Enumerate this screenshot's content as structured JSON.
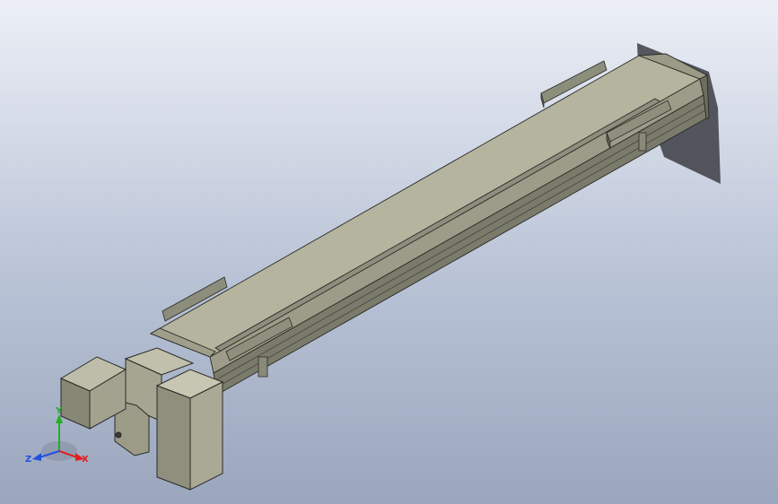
{
  "viewport": {
    "background_top": "#eceff6",
    "background_bottom": "#9aa6bd",
    "model": "linear-actuator-module",
    "part_color": "#aeae9a",
    "part_dark": "#6f6f60",
    "edge_color": "#2a2a26"
  },
  "triad": {
    "x_label": "X",
    "y_label": "Y",
    "z_label": "Z",
    "x_color": "#e02020",
    "y_color": "#20b020",
    "z_color": "#2050e0"
  }
}
